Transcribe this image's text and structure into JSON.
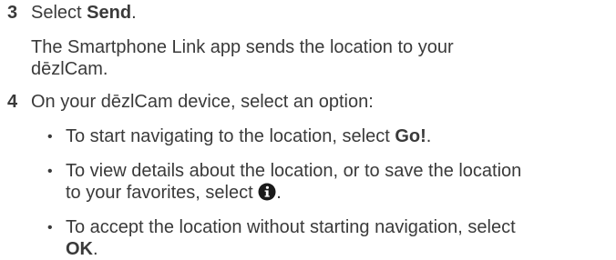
{
  "step3": {
    "number": "3",
    "text_prefix": "Select ",
    "text_bold": "Send",
    "text_suffix": ".",
    "para_line1": "The Smartphone Link app sends the location to your",
    "para_line2": "dēzlCam."
  },
  "step4": {
    "number": "4",
    "text": "On your dēzlCam device, select an option:",
    "bullets": [
      {
        "marker": "•",
        "line1_prefix": "To start navigating to the location, select ",
        "line1_bold": "Go!",
        "line1_suffix": "."
      },
      {
        "marker": "•",
        "line1": "To view details about the location, or to save the location",
        "line2_prefix": "to your favorites, select ",
        "icon": "info-circle-icon",
        "line2_suffix": "."
      },
      {
        "marker": "•",
        "line1": "To accept the location without starting navigation, select",
        "line2_bold": "OK",
        "line2_suffix": "."
      }
    ]
  }
}
